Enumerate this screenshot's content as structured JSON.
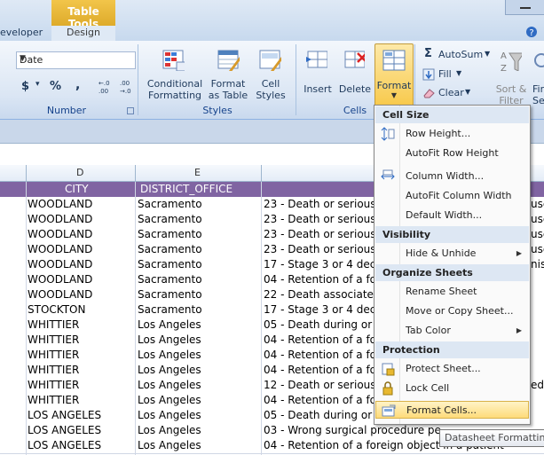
{
  "tabs": {
    "developer": "eveloper",
    "context_group": "Table Tools",
    "design": "Design"
  },
  "ribbon": {
    "number": {
      "format_value": "Date",
      "currency": "$",
      "percent": "%",
      "comma": ",",
      "inc_decimal": ".0 .00",
      "dec_decimal": ".00 .0",
      "group_label": "Number"
    },
    "styles": {
      "conditional_formatting": "Conditional Formatting",
      "cf_line1": "Conditional",
      "cf_line2": "Formatting",
      "fat_line1": "Format",
      "fat_line2": "as Table",
      "cs_line1": "Cell",
      "cs_line2": "Styles",
      "group_label": "Styles"
    },
    "cells": {
      "insert": "Insert",
      "delete": "Delete",
      "format": "Format",
      "group_label": "Cells"
    },
    "editing": {
      "autosum": "AutoSum",
      "fill": "Fill",
      "clear": "Clear",
      "sort_line1": "Sort &",
      "sort_line2": "Filter",
      "find_line1": "Fir",
      "find_line2": "Sel"
    }
  },
  "columns": {
    "d": "D",
    "e": "E"
  },
  "header_row": {
    "city": "CITY",
    "district_office": "DISTRICT_OFFICE"
  },
  "rows": [
    {
      "city": "WOODLAND",
      "office": "Sacramento",
      "event": "23 - Death or serious"
    },
    {
      "city": "WOODLAND",
      "office": "Sacramento",
      "event": "23 - Death or serious"
    },
    {
      "city": "WOODLAND",
      "office": "Sacramento",
      "event": "23 - Death or serious"
    },
    {
      "city": "WOODLAND",
      "office": "Sacramento",
      "event": "23 - Death or serious"
    },
    {
      "city": "WOODLAND",
      "office": "Sacramento",
      "event": "17 - Stage 3 or 4 dec"
    },
    {
      "city": "WOODLAND",
      "office": "Sacramento",
      "event": "04 - Retention of a for"
    },
    {
      "city": "WOODLAND",
      "office": "Sacramento",
      "event": "22 - Death associated"
    },
    {
      "city": "STOCKTON",
      "office": "Sacramento",
      "event": "17 - Stage 3 or 4 dec"
    },
    {
      "city": "WHITTIER",
      "office": "Los Angeles",
      "event": "05 - Death during or u"
    },
    {
      "city": "WHITTIER",
      "office": "Los Angeles",
      "event": "04 - Retention of a for"
    },
    {
      "city": "WHITTIER",
      "office": "Los Angeles",
      "event": "04 - Retention of a for"
    },
    {
      "city": "WHITTIER",
      "office": "Los Angeles",
      "event": "04 - Retention of a for"
    },
    {
      "city": "WHITTIER",
      "office": "Los Angeles",
      "event": "12 - Death or serious"
    },
    {
      "city": "WHITTIER",
      "office": "Los Angeles",
      "event": "04 - Retention of a for"
    },
    {
      "city": "LOS ANGELES",
      "office": "Los Angeles",
      "event": "05 - Death during or u"
    },
    {
      "city": "LOS ANGELES",
      "office": "Los Angeles",
      "event": "03 - Wrong surgical procedure pe"
    },
    {
      "city": "LOS ANGELES",
      "office": "Los Angeles",
      "event": "04 - Retention of a foreign object in a patient"
    }
  ],
  "right_edge_fragments": [
    "use",
    "use",
    "use",
    "use",
    "nis",
    "",
    "",
    "",
    "",
    "",
    "",
    "",
    "edi",
    "",
    "",
    "",
    ""
  ],
  "menu": {
    "cell_size": "Cell Size",
    "row_height": "Row Height...",
    "autofit_row_height": "AutoFit Row Height",
    "column_width": "Column Width...",
    "autofit_column_width": "AutoFit Column Width",
    "default_width": "Default Width...",
    "visibility": "Visibility",
    "hide_unhide": "Hide & Unhide",
    "organize_sheets": "Organize Sheets",
    "rename_sheet": "Rename Sheet",
    "move_copy_sheet": "Move or Copy Sheet...",
    "tab_color": "Tab Color",
    "protection": "Protection",
    "protect_sheet": "Protect Sheet...",
    "lock_cell": "Lock Cell",
    "format_cells": "Format Cells..."
  },
  "tooltip": "Datasheet Formatting",
  "colors": {
    "header_purple": "#8064a2",
    "table_tools": "#e0a92a",
    "highlight": "#fedb7a"
  }
}
